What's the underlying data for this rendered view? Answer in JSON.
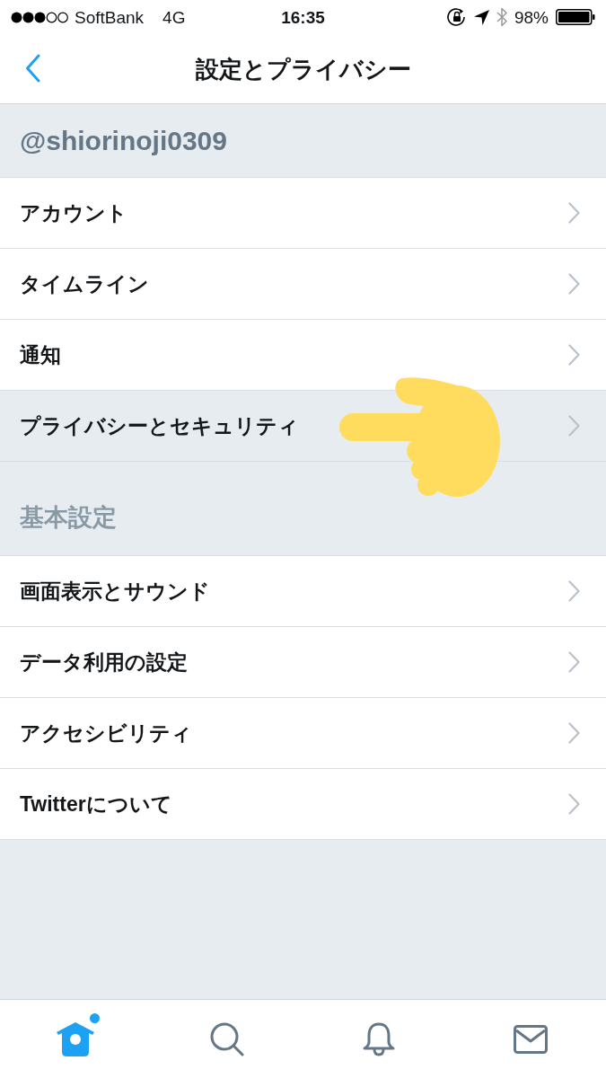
{
  "status_bar": {
    "carrier": "SoftBank",
    "network": "4G",
    "time": "16:35",
    "battery": "98%"
  },
  "header": {
    "title": "設定とプライバシー"
  },
  "sections": [
    {
      "kind": "account",
      "title": "@shiorinoji0309",
      "items": [
        {
          "label": "アカウント",
          "selected": false
        },
        {
          "label": "タイムライン",
          "selected": false
        },
        {
          "label": "通知",
          "selected": false
        },
        {
          "label": "プライバシーとセキュリティ",
          "selected": true
        }
      ]
    },
    {
      "kind": "general",
      "title": "基本設定",
      "items": [
        {
          "label": "画面表示とサウンド",
          "selected": false
        },
        {
          "label": "データ利用の設定",
          "selected": false
        },
        {
          "label": "アクセシビリティ",
          "selected": false
        },
        {
          "label": "Twitterについて",
          "selected": false
        }
      ]
    }
  ],
  "tab_bar": [
    {
      "kind": "home",
      "selected": true,
      "badge": true
    },
    {
      "kind": "search",
      "selected": false,
      "badge": false
    },
    {
      "kind": "notifications",
      "selected": false,
      "badge": false
    },
    {
      "kind": "messages",
      "selected": false,
      "badge": false
    }
  ]
}
